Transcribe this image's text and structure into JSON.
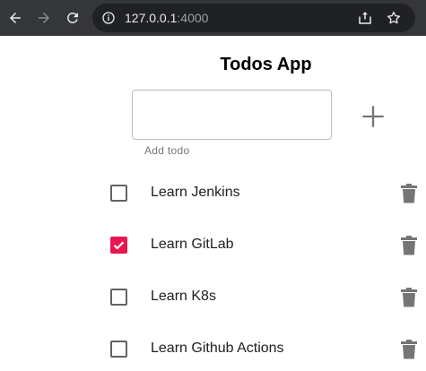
{
  "browser": {
    "url_host": "127.0.0.1",
    "url_port": ":4000",
    "icons": [
      "back-arrow-icon",
      "forward-arrow-icon",
      "reload-icon",
      "info-icon",
      "share-icon",
      "star-icon"
    ]
  },
  "app": {
    "title": "Todos App",
    "input": {
      "value": "",
      "helper": "Add todo"
    },
    "add_icon": "plus-icon"
  },
  "todos": [
    {
      "text": "Learn Jenkins",
      "done": false
    },
    {
      "text": "Learn GitLab",
      "done": true
    },
    {
      "text": "Learn K8s",
      "done": false
    },
    {
      "text": "Learn Github Actions",
      "done": false
    }
  ],
  "colors": {
    "checked_accent": "#e8174f",
    "browser_chrome": "#35363a",
    "icon_gray": "#757575"
  }
}
